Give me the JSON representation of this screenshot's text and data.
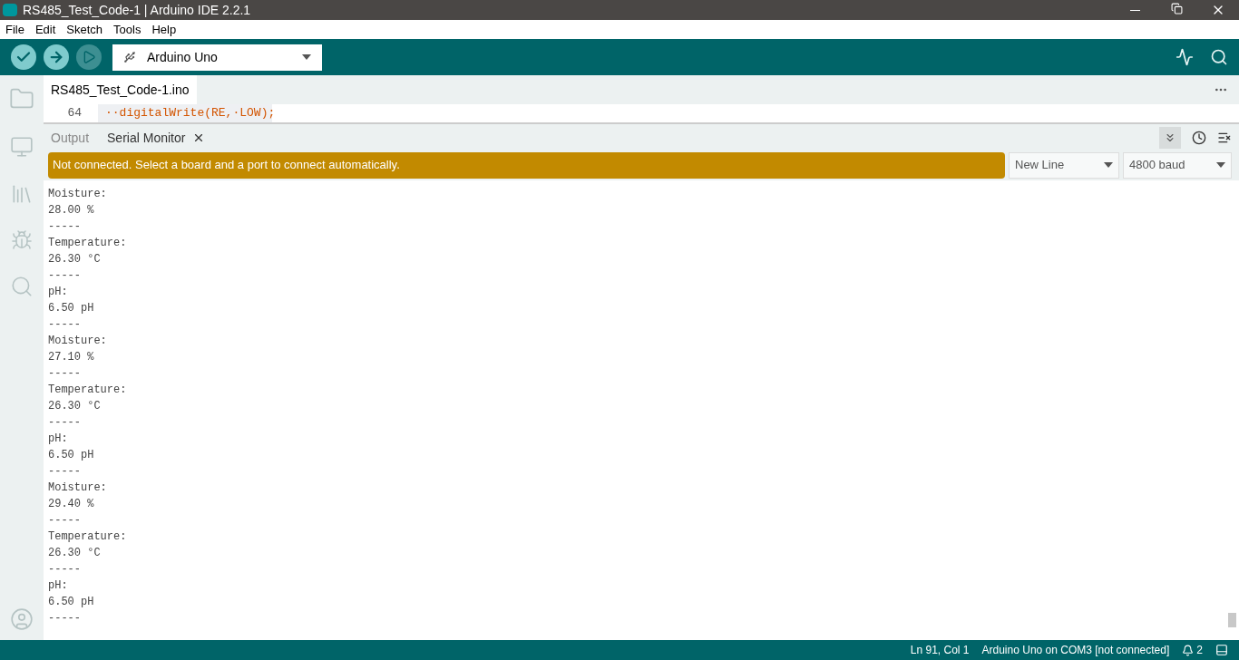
{
  "window": {
    "title": "RS485_Test_Code-1 | Arduino IDE 2.2.1"
  },
  "menu": [
    "File",
    "Edit",
    "Sketch",
    "Tools",
    "Help"
  ],
  "toolbar": {
    "board": "Arduino Uno"
  },
  "editor": {
    "tab": "RS485_Test_Code-1.ino",
    "lines": [
      {
        "number": "64",
        "code": "··digitalWrite(RE,·LOW);"
      }
    ]
  },
  "panel": {
    "tabs": [
      {
        "label": "Output",
        "selected": false,
        "closable": false
      },
      {
        "label": "Serial Monitor",
        "selected": true,
        "closable": true
      }
    ],
    "autoscroll": true,
    "banner": "Not connected. Select a board and a port to connect automatically.",
    "line_ending": "New Line",
    "baud": "4800 baud",
    "output": [
      "Moisture:",
      "28.00 %",
      "-----",
      "Temperature:",
      "26.30 °C",
      "-----",
      "pH:",
      "6.50 pH",
      "-----",
      "Moisture:",
      "27.10 %",
      "-----",
      "Temperature:",
      "26.30 °C",
      "-----",
      "pH:",
      "6.50 pH",
      "-----",
      "Moisture:",
      "29.40 %",
      "-----",
      "Temperature:",
      "26.30 °C",
      "-----",
      "pH:",
      "6.50 pH",
      "-----"
    ]
  },
  "status_bar": {
    "position": "Ln 91, Col 1",
    "board": "Arduino Uno on COM3 [not connected]",
    "notifications": "2"
  }
}
